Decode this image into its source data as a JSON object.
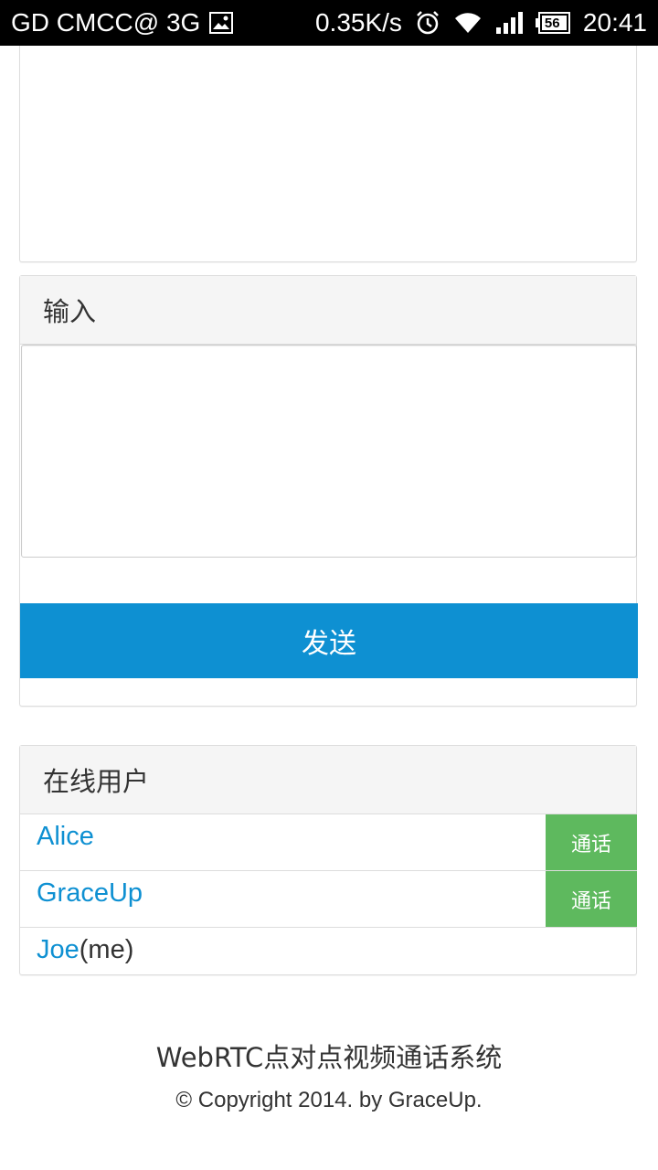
{
  "statusbar": {
    "carrier": "GD CMCC@ 3G",
    "speed": "0.35K/s",
    "battery": "56",
    "time": "20:41",
    "icons": [
      "image-icon",
      "alarm-icon",
      "wifi-icon",
      "signal-icon",
      "battery-icon"
    ]
  },
  "input_panel": {
    "heading": "输入",
    "textarea_value": "",
    "send_label": "发送"
  },
  "users_panel": {
    "heading": "在线用户",
    "users": [
      {
        "name": "Alice",
        "suffix": "",
        "call_label": "通话"
      },
      {
        "name": "GraceUp",
        "suffix": "",
        "call_label": "通话"
      },
      {
        "name": "Joe",
        "suffix": "(me)",
        "call_label": ""
      }
    ]
  },
  "footer": {
    "title": "WebRTC点对点视频通话系统",
    "copyright": "© Copyright 2014. by GraceUp."
  },
  "colors": {
    "primary": "#0e90d2",
    "success": "#5eb95e",
    "panel_heading_bg": "#f5f5f5",
    "border": "#dddddd"
  }
}
